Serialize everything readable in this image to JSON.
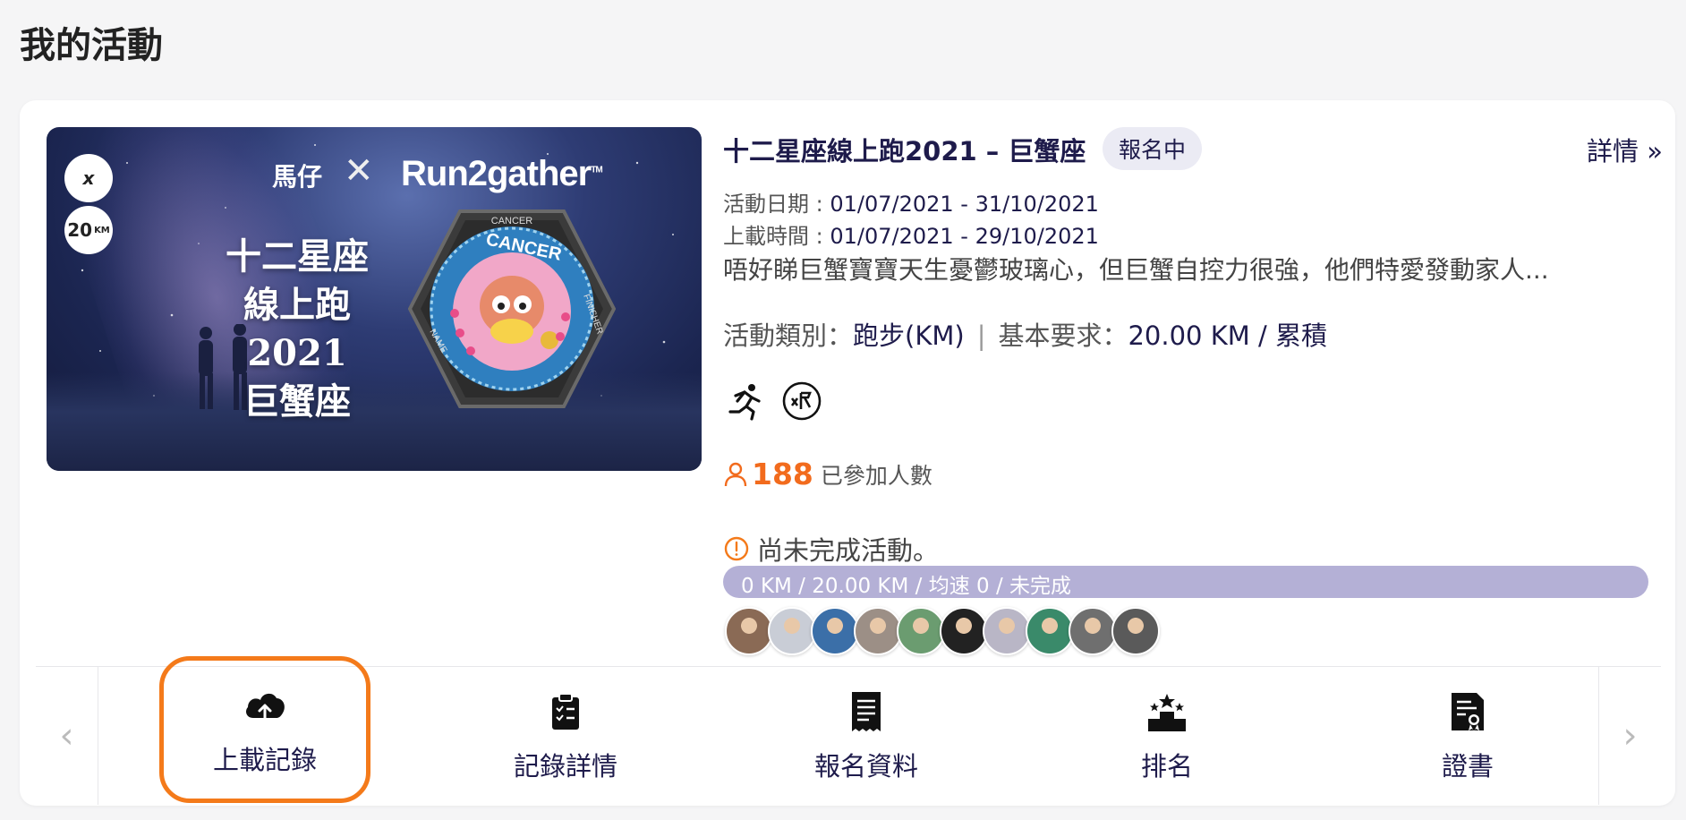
{
  "page": {
    "title": "我的活動"
  },
  "event": {
    "title": "十二星座線上跑2021 – 巨蟹座",
    "status": "報名中",
    "details_link": "詳情 »",
    "date_label": "活動日期 : ",
    "date_value": "01/07/2021 - 31/10/2021",
    "upload_label": "上載時間 : ",
    "upload_value": "01/07/2021 - 29/10/2021",
    "description": "唔好睇巨蟹寶寶天生憂鬱玻璃心，但巨蟹自控力很強，他們特愛發動家人...",
    "type_label": "活動類別：",
    "type_value": "跑步(KM)",
    "requirement_label": "基本要求：",
    "requirement_value": "20.00 KM / 累積",
    "participants_count": "188",
    "participants_label": "已參加人數",
    "completion_status": "尚未完成活動。",
    "progress_text": "0 KM / 20.00 KM / 均速 0 / 未完成",
    "progress_fraction": 0,
    "banner": {
      "brand_left": "馬仔",
      "brand_x": "✕",
      "brand_right": "Run2gather",
      "brand_tm": "TM",
      "title_line1": "十二星座",
      "title_line2": "線上跑2021",
      "title_line3": "巨蟹座",
      "logo1": "x",
      "logo2": "20",
      "logo2_unit": "KM",
      "medal_top": "CANCER",
      "medal_band": "CANCER",
      "medal_left": "NAME",
      "medal_right": "FINISHER"
    }
  },
  "actions": [
    {
      "label": "上載記錄",
      "icon": "cloud-upload-icon"
    },
    {
      "label": "記錄詳情",
      "icon": "clipboard-check-icon"
    },
    {
      "label": "報名資料",
      "icon": "receipt-icon"
    },
    {
      "label": "排名",
      "icon": "podium-icon"
    },
    {
      "label": "證書",
      "icon": "certificate-icon"
    }
  ],
  "nav": {
    "prev": "‹",
    "next": "›"
  },
  "colors": {
    "accent": "#1e1b4b",
    "orange": "#f26b1d",
    "highlight": "#f47a1a",
    "progress": "#b4b0d6"
  },
  "avatar_colors": [
    "#8a6a55",
    "#c9cdd6",
    "#3b6fa8",
    "#9c8f86",
    "#6b9c70",
    "#222222",
    "#b9b6c6",
    "#3a8a6a",
    "#6f6f6f",
    "#5a5a5a"
  ]
}
